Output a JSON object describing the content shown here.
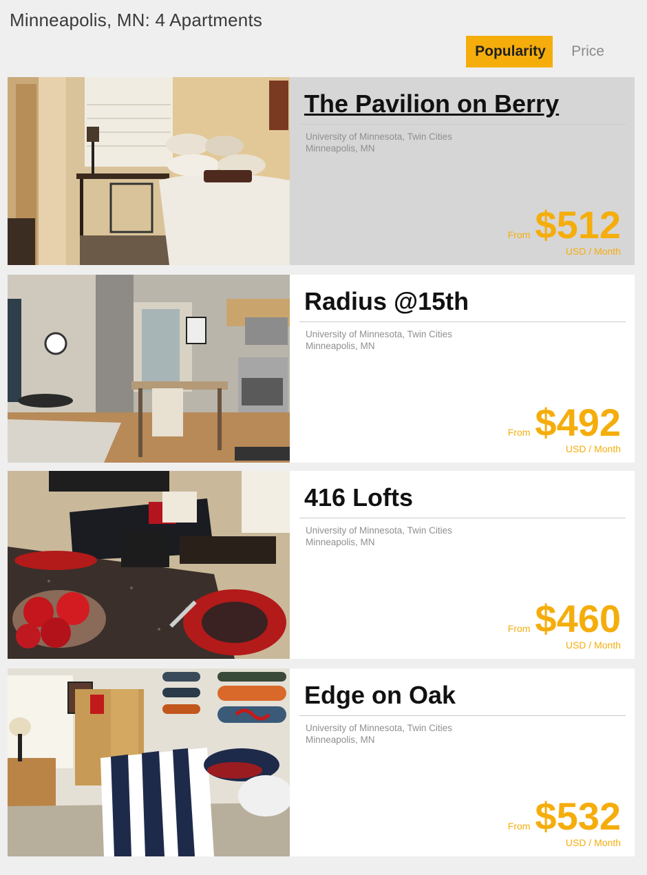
{
  "header": {
    "title": "Minneapolis, MN: 4 Apartments"
  },
  "sort": {
    "options": [
      "Popularity",
      "Price"
    ],
    "active": "Popularity"
  },
  "accent_color": "#f5ad0c",
  "listings": [
    {
      "name": "The Pavilion on Berry",
      "school": "University of Minnesota, Twin Cities",
      "city": "Minneapolis, MN",
      "from_label": "From",
      "price": "$512",
      "unit": "USD / Month",
      "highlighted": true
    },
    {
      "name": "Radius @15th",
      "school": "University of Minnesota, Twin Cities",
      "city": "Minneapolis, MN",
      "from_label": "From",
      "price": "$492",
      "unit": "USD / Month",
      "highlighted": false
    },
    {
      "name": "416 Lofts",
      "school": "University of Minnesota, Twin Cities",
      "city": "Minneapolis, MN",
      "from_label": "From",
      "price": "$460",
      "unit": "USD / Month",
      "highlighted": false
    },
    {
      "name": "Edge on Oak",
      "school": "University of Minnesota, Twin Cities",
      "city": "Minneapolis, MN",
      "from_label": "From",
      "price": "$532",
      "unit": "USD / Month",
      "highlighted": false
    }
  ]
}
